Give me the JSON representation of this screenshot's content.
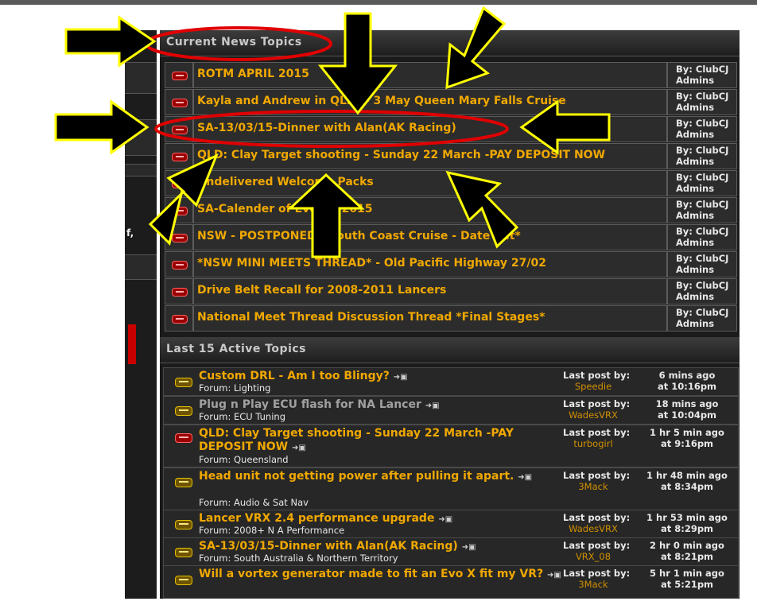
{
  "news": {
    "header": "Current News Topics",
    "topics": [
      {
        "title": "ROTM APRIL 2015",
        "by_label": "By:",
        "by": "ClubCJ Admins"
      },
      {
        "title": "Kayla and Andrew in QLD! - 3 May Queen Mary Falls Cruise",
        "by_label": "By:",
        "by": "ClubCJ Admins"
      },
      {
        "title": "SA-13/03/15-Dinner with Alan(AK Racing)",
        "by_label": "By:",
        "by": "ClubCJ Admins"
      },
      {
        "title": "QLD: Clay Target shooting - Sunday 22 March -PAY DEPOSIT NOW",
        "by_label": "By:",
        "by": "ClubCJ Admins"
      },
      {
        "title": "Undelivered Welcome Packs",
        "by_label": "By:",
        "by": "ClubCJ Admins"
      },
      {
        "title": "SA-Calender of Events-2015",
        "by_label": "By:",
        "by": "ClubCJ Admins"
      },
      {
        "title": "NSW - POSTPONED - South Coast Cruise - Date Set*",
        "by_label": "By:",
        "by": "ClubCJ Admins"
      },
      {
        "title": "*NSW MINI MEETS THREAD* - Old Pacific Highway 27/02",
        "by_label": "By:",
        "by": "ClubCJ Admins"
      },
      {
        "title": "Drive Belt Recall for 2008-2011 Lancers",
        "by_label": "By:",
        "by": "ClubCJ Admins"
      },
      {
        "title": "National Meet Thread Discussion Thread *Final Stages*",
        "by_label": "By:",
        "by": "ClubCJ Admins"
      }
    ]
  },
  "active": {
    "header": "Last 15 Active Topics",
    "topics": [
      {
        "title": "Custom DRL - Am I too Blingy?",
        "forum": "Forum: Lighting",
        "last_post_label": "Last post by:",
        "user": "Speedie",
        "ago": "6 mins ago",
        "time": "at 10:16pm"
      },
      {
        "title": "Plug n Play ECU flash for NA Lancer",
        "forum": "Forum: ECU Tuning",
        "last_post_label": "Last post by:",
        "user": "WadesVRX",
        "ago": "18 mins ago",
        "time": "at 10:04pm"
      },
      {
        "title": "QLD: Clay Target shooting - Sunday 22 March -PAY DEPOSIT NOW",
        "forum": "Forum: Queensland",
        "last_post_label": "Last post by:",
        "user": "turbogirl",
        "ago": "1 hr 5 min ago",
        "time": "at 9:16pm"
      },
      {
        "title": "Head unit not getting power after pulling it apart.",
        "forum": "Forum: Audio & Sat Nav",
        "last_post_label": "Last post by:",
        "user": "3Mack",
        "ago": "1 hr 48 min ago",
        "time": "at 8:34pm"
      },
      {
        "title": "Lancer VRX 2.4 performance upgrade",
        "forum": "Forum: 2008+ N A Performance",
        "last_post_label": "Last post by:",
        "user": "WadesVRX",
        "ago": "1 hr 53 min ago",
        "time": "at 8:29pm"
      },
      {
        "title": "SA-13/03/15-Dinner with Alan(AK Racing)",
        "forum": "Forum: South Australia & Northern Territory",
        "last_post_label": "Last post by:",
        "user": "VRX_08",
        "ago": "2 hr 0 min ago",
        "time": "at 8:21pm"
      },
      {
        "title": "Will a vortex generator made to fit an Evo X fit my VR?",
        "forum": "",
        "last_post_label": "Last post by:",
        "user": "3Mack",
        "ago": "5 hr 1 min ago",
        "time": "at 5:21pm"
      }
    ]
  },
  "sidebar": {
    "fragment": "f,"
  },
  "colors": {
    "title": "#f0a800",
    "panel": "#1b1b1b",
    "annotation_red": "#e00000",
    "arrow_fill": "#000000",
    "arrow_outline": "#ffff00"
  }
}
